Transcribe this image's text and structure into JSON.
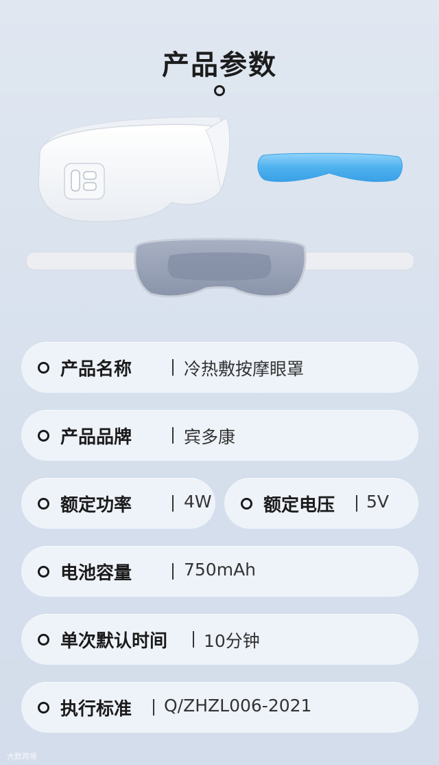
{
  "title": "产品参数",
  "params": [
    {
      "label": "产品名称",
      "value": "冷热敷按摩眼罩"
    },
    {
      "label": "产品品牌",
      "value": "宾多康"
    },
    {
      "label": "额定功率",
      "value": "4W"
    },
    {
      "label": "额定电压",
      "value": "5V"
    },
    {
      "label": "电池容量",
      "value": "750mAh"
    },
    {
      "label": "单次默认时间",
      "value": "10分钟"
    },
    {
      "label": "执行标准",
      "value": "Q/ZHZL006-2021"
    }
  ],
  "watermark": "大数跨境",
  "colors": {
    "background": "#d6e0ec",
    "pill": "#eef3f9",
    "text": "#1a1a1a",
    "gel_pad": "#5cb8ef",
    "mask_inner": "#8c97ad"
  }
}
